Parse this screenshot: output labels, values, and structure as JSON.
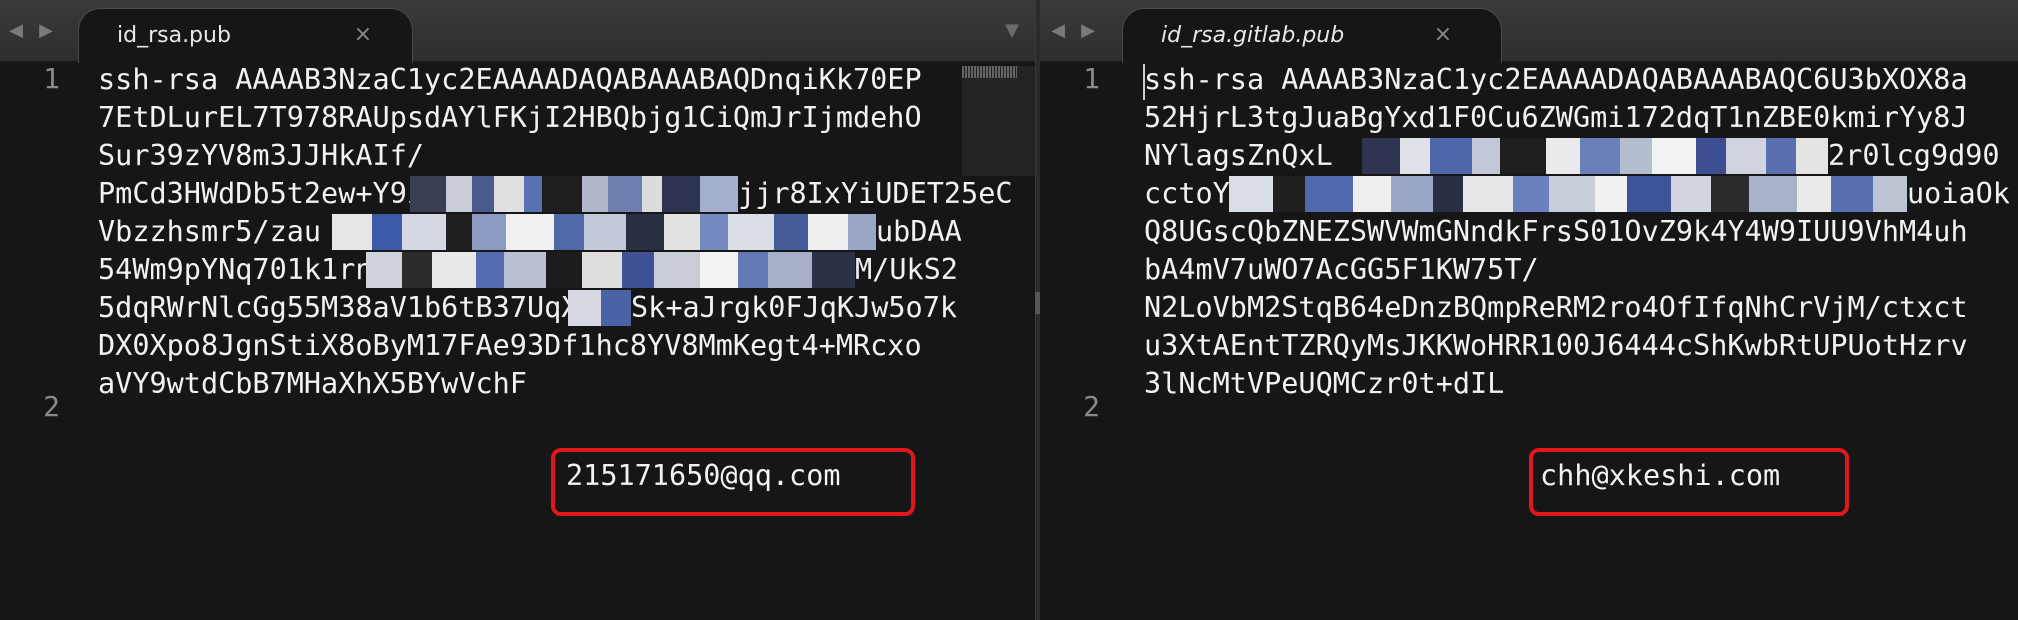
{
  "left_pane": {
    "tab": {
      "title": "id_rsa.pub",
      "close": "×"
    },
    "nav": {
      "back": "◀",
      "forward": "▶"
    },
    "tab_menu": "▼",
    "line_numbers": [
      "1",
      "2"
    ],
    "lines": [
      "ssh-rsa AAAAB3NzaC1yc2EAAAADAQABAAABAQDnqiKk70EP",
      "7EtDLurEL7T978RAUpsdAYlFKjI2HBQbjg1CiQmJrIjmdehO",
      "Sur39zYV8m3JJHkAIf/",
      "PmCd3HWdDb5t2ew+Y9iHcl",
      "Vbzzhsmr5/zau",
      "54Wm9pYNq701k1rn",
      "5dqRWrNlcGg55M38aV1b6tB37UqX0",
      "DX0Xpo8JgnStiX8oByM17FAe93Df1hc8YV8MmKegt4+MRcxo",
      "aVY9wtdCbB7MHaXhX5BYwVchF"
    ],
    "line_tails": [
      "",
      "",
      "",
      "jjr8IxYiUDET25eC",
      "ubDAA",
      "M/UkS2",
      "Sk+aJrgk0FJqKJw5o7k",
      "",
      ""
    ],
    "email": "215171650@qq.com"
  },
  "right_pane": {
    "tab": {
      "title": "id_rsa.gitlab.pub",
      "close": "×"
    },
    "nav": {
      "back": "◀",
      "forward": "▶"
    },
    "line_numbers": [
      "1",
      "2"
    ],
    "lines": [
      "ssh-rsa AAAAB3NzaC1yc2EAAAADAQABAAABAQC6U3bXOX8a",
      "52HjrL3tgJuaBgYxd1F0Cu6ZWGmi172dqT1nZBE0kmirYy8J",
      "NYlagsZnQxL",
      "cctoY",
      "Q8UGscQbZNEZSWVWmGNndkFrsS01OvZ9k4Y4W9IUU9VhM4uh",
      "bA4mV7uWO7AcGG5F1KW75T/",
      "N2LoVbM2StqB64eDnzBQmpReRM2ro4OfIfqNhCrVjM/ctxct",
      "u3XtAEntTZRQyMsJKKWoHRR100J6444cShKwbRtUPUotHzrv",
      "3lNcMtVPeUQMCzr0t+dIL"
    ],
    "line_tails": [
      "",
      "",
      "2r0lcg9d90",
      "uoiaOk",
      "",
      "",
      "",
      "",
      ""
    ],
    "email": "chh@xkeshi.com"
  },
  "colors": {
    "background": "#161616",
    "text": "#f2f2f2",
    "line_number": "#8a8a8a",
    "highlight": "#e0171d"
  }
}
